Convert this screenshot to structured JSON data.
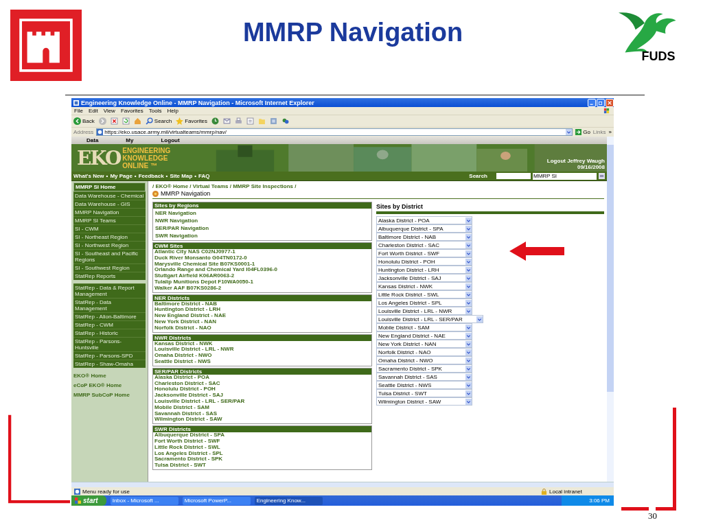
{
  "slide": {
    "title": "MMRP Navigation",
    "logo_text": "FUDS",
    "page_number": "30"
  },
  "browser": {
    "title": "Engineering Knowledge Online - MMRP Navigation - Microsoft Internet Explorer",
    "menu": [
      "File",
      "Edit",
      "View",
      "Favorites",
      "Tools",
      "Help"
    ],
    "toolbar": {
      "back": "Back",
      "search": "Search",
      "favorites": "Favorites"
    },
    "address": {
      "label": "Address",
      "url": "https://eko.usace.army.mil/virtualteams/mmrp/nav/",
      "go": "Go",
      "links": "Links",
      "more": "»"
    },
    "status": "Menu ready for use",
    "zone": "Local intranet"
  },
  "site": {
    "top_menu": [
      "Data",
      "My",
      "Logout"
    ],
    "banner": {
      "logo": "EKO",
      "name_lines": [
        "ENGINEERING",
        "KNOWLEDGE",
        "ONLINE ™"
      ],
      "user": "Logout Jeffrey Waugh",
      "date": "09/16/2008"
    },
    "nav": {
      "separator": "•",
      "links": [
        "What's New",
        "My Page",
        "Feedback",
        "Site Map",
        "FAQ"
      ]
    },
    "search": {
      "label": "Search",
      "scope": "MMRP SI"
    },
    "sidebar": {
      "header": "MMRP SI Home",
      "groups": [
        [
          "Data Warehouse - Chemical",
          "Data Warehouse - GIS",
          "MMRP Navigation",
          "MMRP SI Teams",
          "SI - CWM",
          "SI - Northeast Region",
          "SI - Northwest Region",
          "SI - Southeast and Pacific Regions",
          "SI - Southwest Region",
          "StatRep Reports"
        ],
        [
          "StatRep - Data & Report Management",
          "StatRep - Data Management",
          "StatRep - Alion-Baltimore",
          "StatRep - CWM",
          "StatRep - Historic",
          "StatRep - Parsons-Huntsville",
          "StatRep - Parsons-SPD",
          "StatRep - Shaw-Omaha"
        ]
      ],
      "links": [
        "EKO® Home",
        "eCoP EKO® Home",
        "MMRP SubCoP Home"
      ]
    },
    "breadcrumb": "/ EKO® Home / Virtual Teams / MMRP Site Inspections /",
    "page_title": "MMRP Navigation",
    "panels": [
      {
        "title": "Sites by Regions",
        "kind": "nav",
        "items": [
          "NER Navigation",
          "NWR Navigation",
          "SER/PAR Navigation",
          "SWR Navigation"
        ]
      },
      {
        "title": "CWM Sites",
        "kind": "list",
        "items": [
          "Atlantic City NAS C02NJ0977-1",
          "Duck River Monsanto G04TN0172-0",
          "Marysville Chemical Site B07KS0001-1",
          "Orlando Range and Chemical Yard I04FL0396-0",
          "Stuttgart Airfield K06AR0063-2",
          "Tulalip Munitions Depot F10WA0050-1",
          "Walker AAF B07KS0286-2"
        ]
      },
      {
        "title": "NER Districts",
        "kind": "list",
        "items": [
          "Baltimore District - NAB",
          "Huntington District - LRH",
          "New England District - NAE",
          "New York District - NAN",
          "Norfolk District - NAO"
        ]
      },
      {
        "title": "NWR Districts",
        "kind": "list",
        "items": [
          "Kansas District - NWK",
          "Louisville District - LRL - NWR",
          "Omaha District - NWO",
          "Seattle District - NWS"
        ]
      },
      {
        "title": "SER/PAR Districts",
        "kind": "list",
        "items": [
          "Alaska District - POA",
          "Charleston District - SAC",
          "Honolulu District - POH",
          "Jacksonville District - SAJ",
          "Louisville District - LRL - SER/PAR",
          "Mobile District - SAM",
          "Savannah District - SAS",
          "Wilmington District - SAW"
        ]
      },
      {
        "title": "SWR Districts",
        "kind": "list",
        "items": [
          "Albuquerque District - SPA",
          "Fort Worth District - SWF",
          "Little Rock District - SWL",
          "Los Angeles District - SPL",
          "Sacramento District - SPK",
          "Tulsa District - SWT"
        ]
      }
    ],
    "districts": {
      "title": "Sites by District",
      "selects": [
        "Alaska District - POA",
        "Albuquerque District - SPA",
        "Baltimore District - NAB",
        "Charleston District - SAC",
        "Fort Worth District - SWF",
        "Honolulu District - POH",
        "Huntington District - LRH",
        "Jacksonville District - SAJ",
        "Kansas District - NWK",
        "Little Rock District - SWL",
        "Los Angeles District - SPL",
        "Louisville District - LRL - NWR",
        "Louisville District - LRL - SER/PAR",
        "Mobile District - SAM",
        "New England District - NAE",
        "New York District - NAN",
        "Norfolk District - NAO",
        "Omaha District - NWO",
        "Sacramento District - SPK",
        "Savannah District - SAS",
        "Seattle District - NWS",
        "Tulsa District - SWT",
        "Wilmington District - SAW"
      ]
    }
  },
  "taskbar": {
    "start": "start",
    "tasks": [
      "Inbox - Microsoft ...",
      "Microsoft PowerP...",
      "Engineering Know..."
    ],
    "clock": "3:06 PM"
  }
}
